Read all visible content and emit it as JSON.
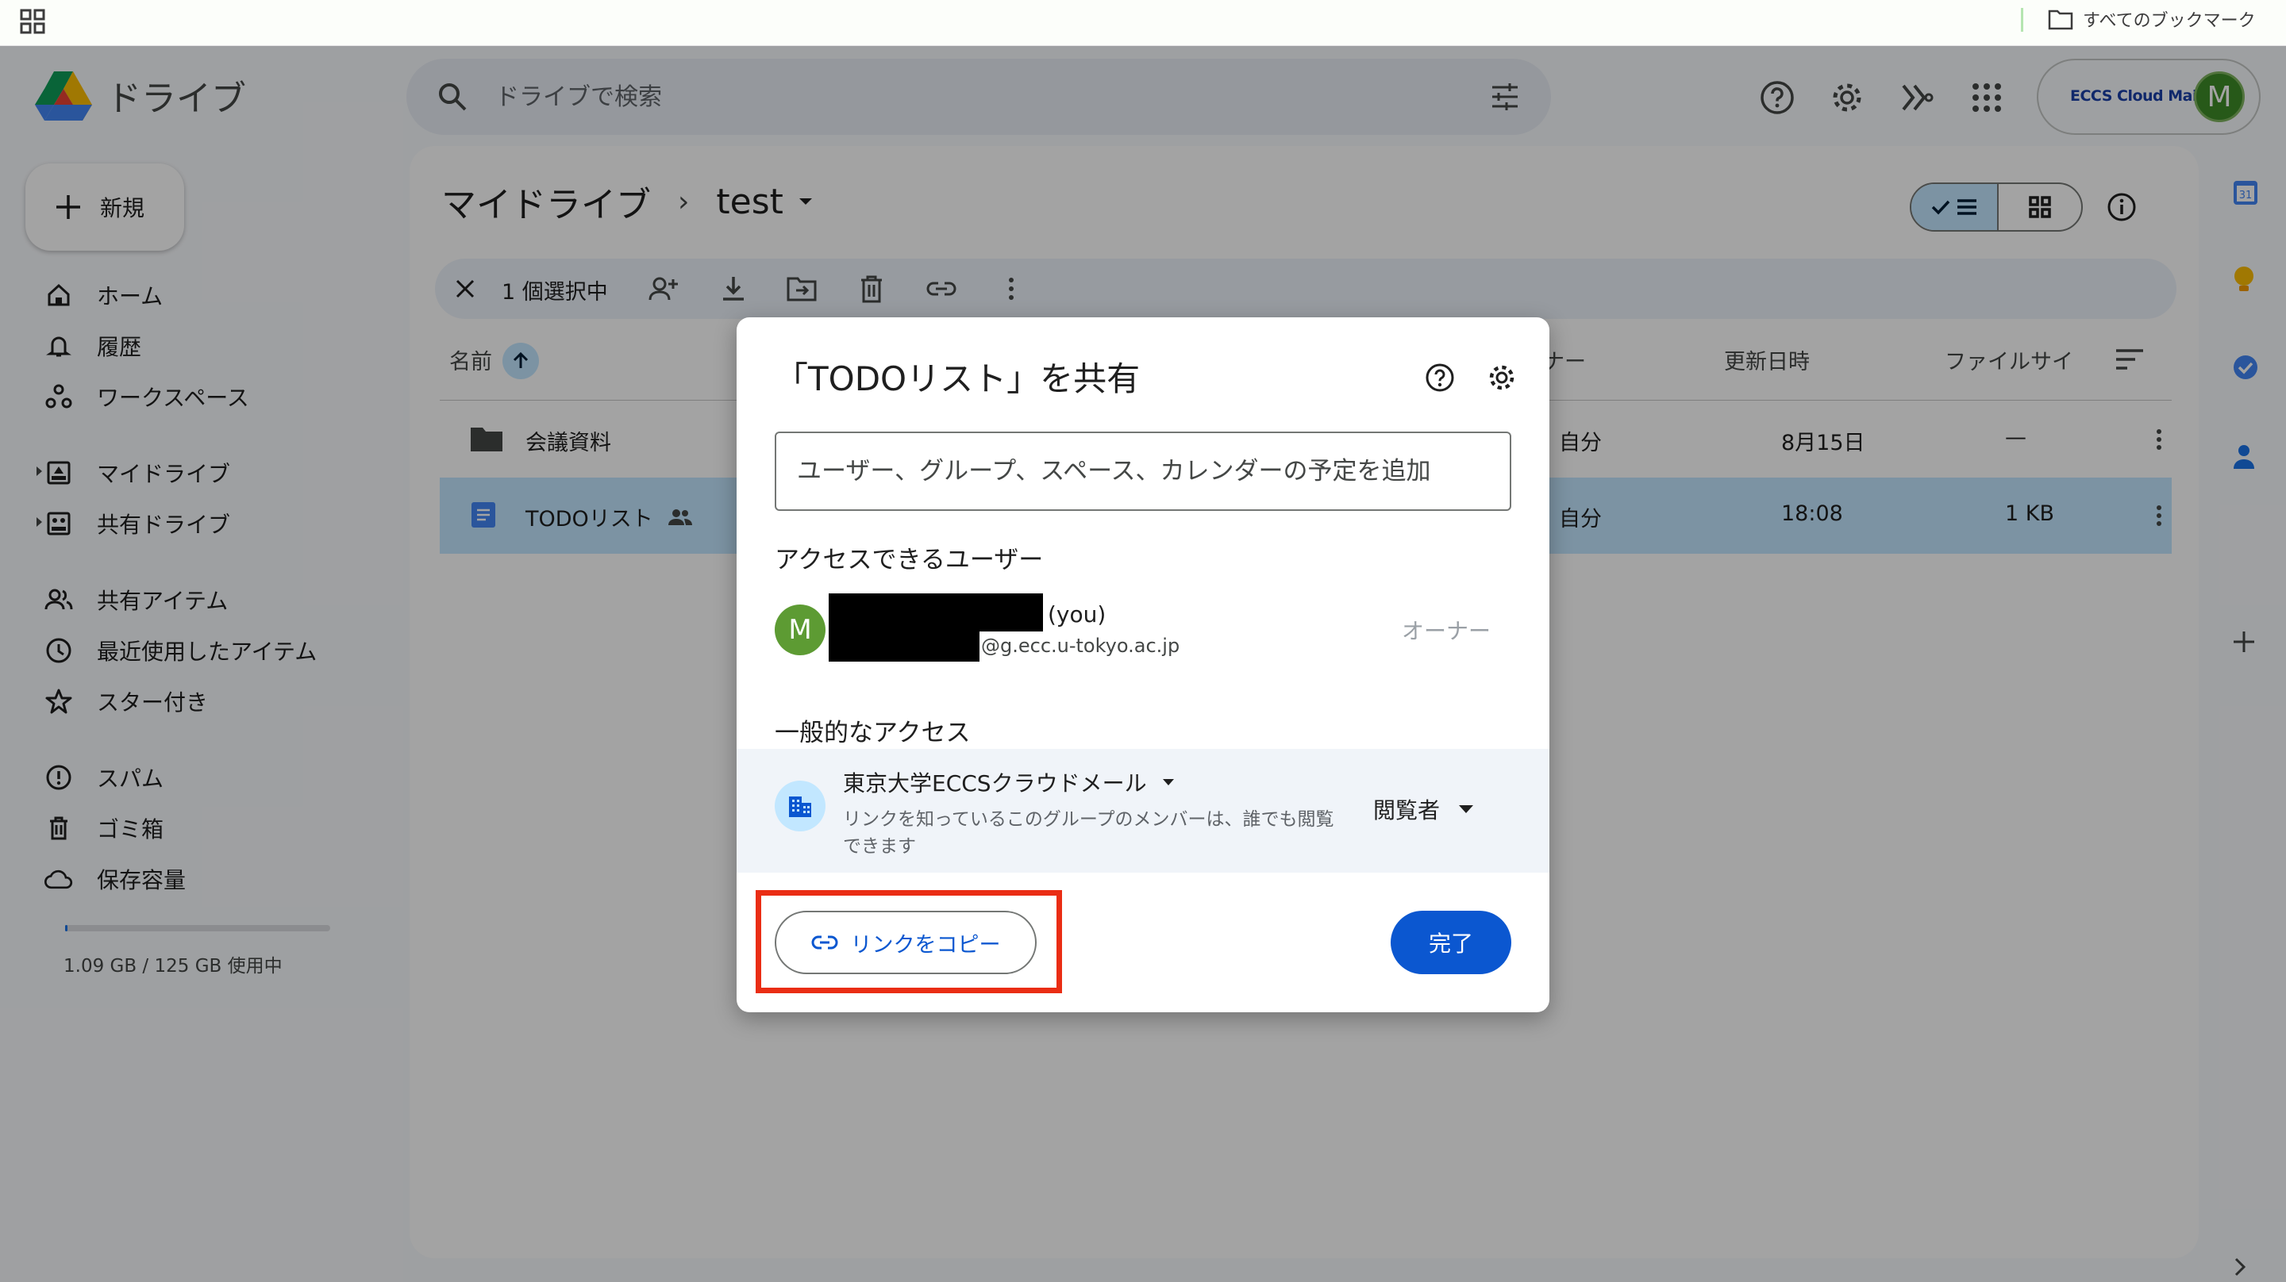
{
  "bookmarks": {
    "all_label": "すべてのブックマーク"
  },
  "app": {
    "title": "ドライブ"
  },
  "search": {
    "placeholder": "ドライブで検索"
  },
  "account": {
    "org": "ECCS Cloud Mail",
    "avatar_letter": "M"
  },
  "sidebar": {
    "new_label": "新規",
    "items": [
      {
        "label": "ホーム",
        "icon": "home-icon"
      },
      {
        "label": "履歴",
        "icon": "bell-icon"
      },
      {
        "label": "ワークスペース",
        "icon": "workspaces-icon"
      },
      {
        "label": "マイドライブ",
        "icon": "my-drive-icon"
      },
      {
        "label": "共有ドライブ",
        "icon": "shared-drives-icon"
      },
      {
        "label": "共有アイテム",
        "icon": "people-icon"
      },
      {
        "label": "最近使用したアイテム",
        "icon": "clock-icon"
      },
      {
        "label": "スター付き",
        "icon": "star-icon"
      },
      {
        "label": "スパム",
        "icon": "spam-icon"
      },
      {
        "label": "ゴミ箱",
        "icon": "trash-icon"
      },
      {
        "label": "保存容量",
        "icon": "cloud-icon"
      }
    ],
    "storage_text": "1.09 GB / 125 GB 使用中",
    "storage_used_fraction": 0.009
  },
  "breadcrumb": {
    "root": "マイドライブ",
    "folder": "test"
  },
  "selection": {
    "count_label": "1 個選択中"
  },
  "table": {
    "columns": {
      "name": "名前",
      "owner": "ナー",
      "modified": "更新日時",
      "size": "ファイルサイ"
    },
    "rows": [
      {
        "name": "会議資料",
        "owner": "自分",
        "modified": "8月15日",
        "size": "—",
        "type": "folder"
      },
      {
        "name": "TODOリスト",
        "owner": "自分",
        "modified": "18:08",
        "size": "1 KB",
        "type": "doc",
        "selected": true
      }
    ]
  },
  "side_panel": {
    "calendar_day": "31"
  },
  "dialog": {
    "title": "「TODOリスト」を共有",
    "add_placeholder": "ユーザー、グループ、スペース、カレンダーの予定を追加",
    "access_section": "アクセスできるユーザー",
    "user": {
      "avatar_letter": "M",
      "you": "(you)",
      "email_suffix": "@g.ecc.u-tokyo.ac.jp",
      "role": "オーナー"
    },
    "general_section": "一般的なアクセス",
    "general": {
      "name": "東京大学ECCSクラウドメール",
      "description": "リンクを知っているこのグループのメンバーは、誰でも閲覧できます",
      "role": "閲覧者"
    },
    "copy_link": "リンクをコピー",
    "done": "完了"
  },
  "colors": {
    "accent": "#0b57d0",
    "selected_row": "#c2e7ff",
    "highlight_border": "#ea2d14"
  }
}
